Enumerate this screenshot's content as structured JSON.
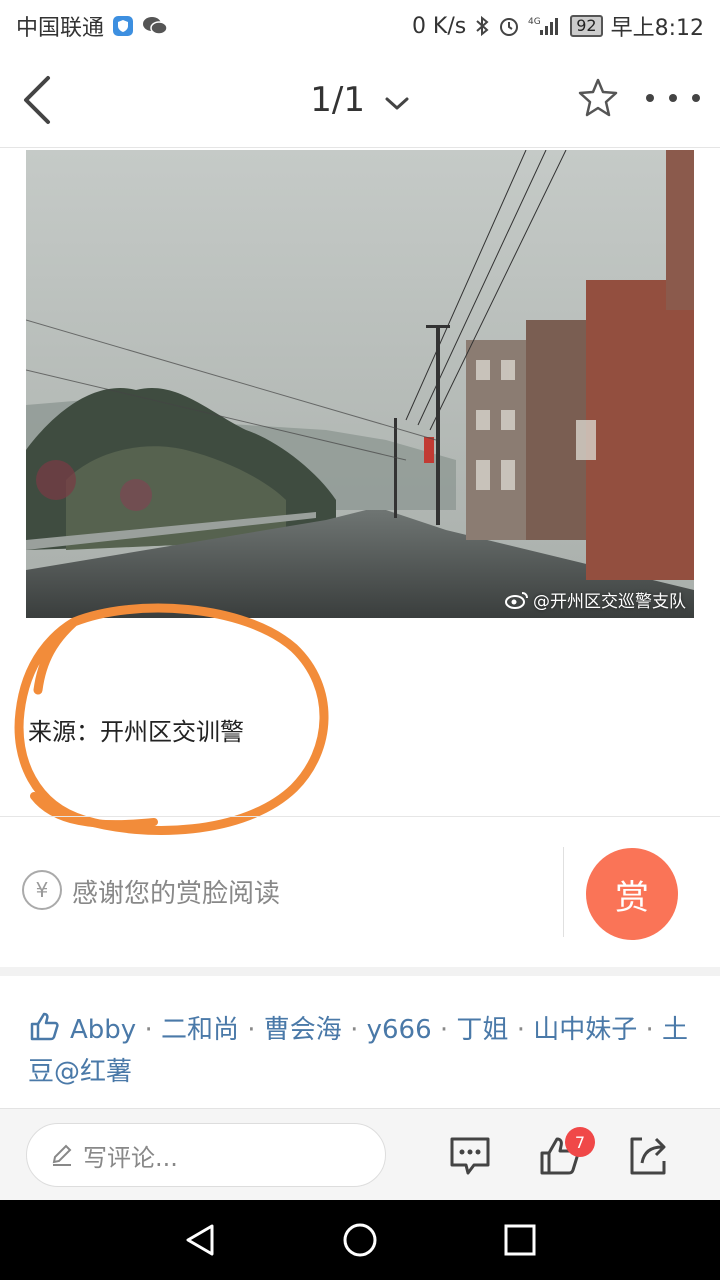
{
  "status_bar": {
    "carrier": "中国联通",
    "net_speed": "0 K/s",
    "battery": "92",
    "time": "早上8:12",
    "signal_label": "4G",
    "icons": [
      "shield-icon",
      "wechat-icon",
      "bluetooth-icon",
      "alarm-icon",
      "signal-icon",
      "battery-icon"
    ]
  },
  "nav": {
    "page_indicator": "1/1",
    "icons": [
      "back-arrow-icon",
      "chevron-down-icon",
      "star-icon",
      "more-icon"
    ]
  },
  "photo": {
    "watermark": "@开州区交巡警支队",
    "watermark_icon": "weibo-icon"
  },
  "article": {
    "source_text": "来源：开州区交训警",
    "annotation_color": "#f28c3a"
  },
  "reward": {
    "thanks_text": "感谢您的赏脸阅读",
    "button_label": "赏",
    "yen_symbol": "¥",
    "button_color": "#fa7457"
  },
  "likes": {
    "names": [
      "Abby",
      "二和尚",
      "曹会海",
      "y666",
      "丁姐",
      "山中妹子",
      "土豆@红薯"
    ],
    "separator": " · ",
    "color": "#4a79a8"
  },
  "comment_bar": {
    "placeholder": "写评论...",
    "like_badge": "7",
    "icons": [
      "pencil-icon",
      "comment-icon",
      "thumbs-up-icon",
      "share-icon"
    ]
  },
  "system_nav": {
    "icons": [
      "back-triangle-icon",
      "home-circle-icon",
      "recents-square-icon"
    ]
  }
}
